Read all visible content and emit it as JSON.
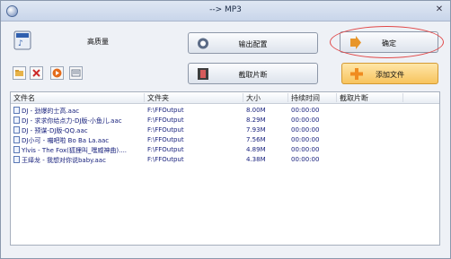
{
  "window": {
    "title": "--> MP3"
  },
  "profile": {
    "quality": "高质量"
  },
  "buttons": {
    "output_config": "输出配置",
    "clip": "截取片断",
    "confirm": "确定",
    "add_file": "添加文件"
  },
  "table": {
    "headers": [
      "文件名",
      "文件夹",
      "大小",
      "持续时间",
      "截取片断"
    ],
    "rows": [
      {
        "name": "DJ - 劲爆的士高.aac",
        "folder": "F:\\FFOutput",
        "size": "8.00M",
        "duration": "00:00:00"
      },
      {
        "name": "DJ - 求求你给点力-DJ版-小鱼儿.aac",
        "folder": "F:\\FFOutput",
        "size": "8.29M",
        "duration": "00:00:00"
      },
      {
        "name": "DJ - 预谋-DJ版-QQ.aac",
        "folder": "F:\\FFOutput",
        "size": "7.93M",
        "duration": "00:00:00"
      },
      {
        "name": "DJ小可 - 嘣吧啦 Bo Ba La.aac",
        "folder": "F:\\FFOutput",
        "size": "7.56M",
        "duration": "00:00:00"
      },
      {
        "name": "Ylvis - The Fox(狐狸叫_嘿威神曲)....",
        "folder": "F:\\FFOutput",
        "size": "4.89M",
        "duration": "00:00:00"
      },
      {
        "name": "王绎龙 - 我想对你说baby.aac",
        "folder": "F:\\FFOutput",
        "size": "4.38M",
        "duration": "00:00:00"
      }
    ]
  }
}
